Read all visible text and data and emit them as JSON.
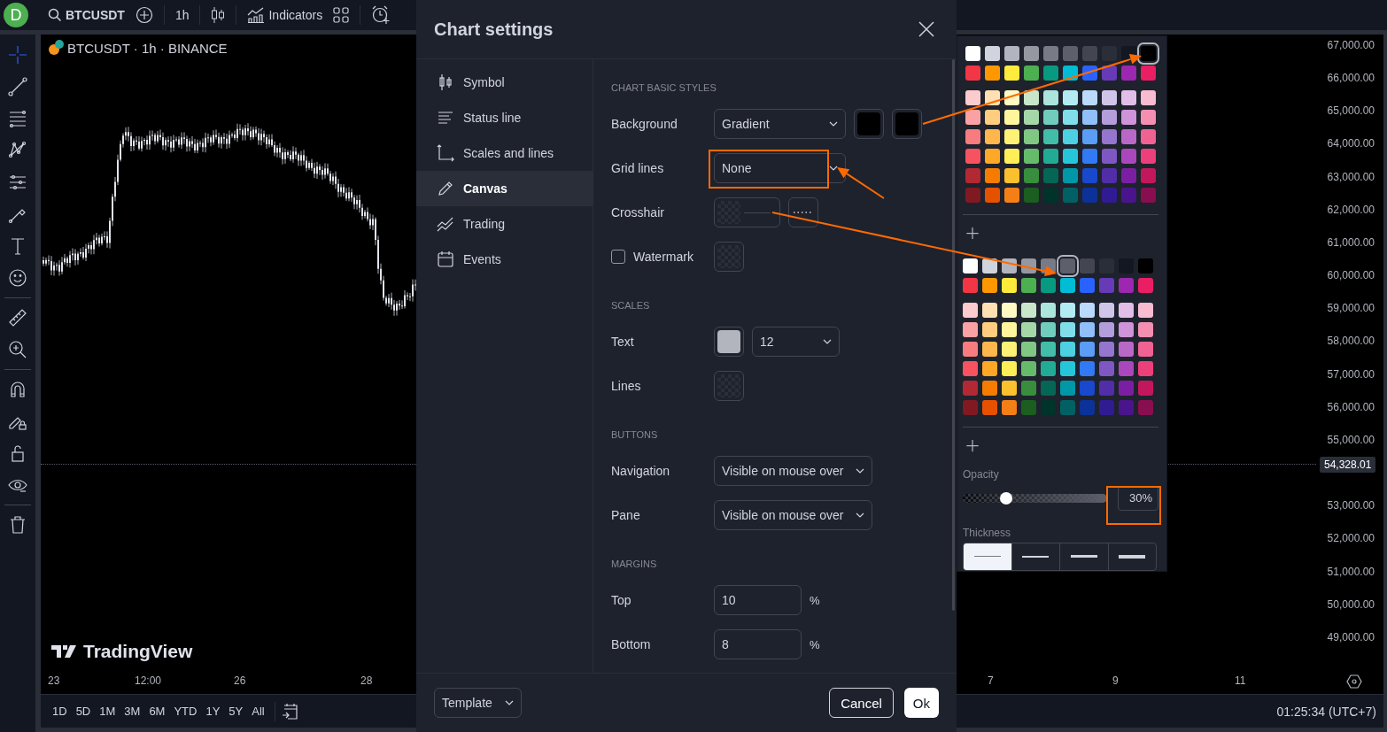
{
  "top_bar": {
    "avatar": "D",
    "symbol": "BTCUSDT",
    "interval": "1h",
    "indicators": "Indicators"
  },
  "tool_groups": [
    {
      "tools": [
        {
          "kind": "crosshair",
          "selected": true
        },
        {
          "kind": "trend-line",
          "selected": false
        },
        {
          "kind": "fib",
          "selected": false
        },
        {
          "kind": "pattern",
          "selected": false
        },
        {
          "kind": "forecast",
          "selected": false
        },
        {
          "kind": "brush",
          "selected": false
        },
        {
          "kind": "text",
          "selected": false
        },
        {
          "kind": "smiley",
          "selected": false
        }
      ]
    },
    {
      "tools": [
        {
          "kind": "ruler",
          "selected": false
        },
        {
          "kind": "zoom",
          "selected": false
        }
      ]
    },
    {
      "tools": [
        {
          "kind": "magnet",
          "selected": false
        },
        {
          "kind": "lock-drawing",
          "selected": false
        },
        {
          "kind": "lock",
          "selected": false
        },
        {
          "kind": "eye",
          "selected": false
        }
      ]
    },
    {
      "tools": [
        {
          "kind": "trash",
          "selected": false
        }
      ]
    }
  ],
  "chart": {
    "legend": "BTCUSDT · 1h · BINANCE",
    "watermark": "TradingView",
    "price_labels": [
      "67,000.00",
      "66,000.00",
      "65,000.00",
      "64,000.00",
      "63,000.00",
      "62,000.00",
      "61,000.00",
      "60,000.00",
      "59,000.00",
      "58,000.00",
      "57,000.00",
      "56,000.00",
      "55,000.00",
      "53,000.00",
      "52,000.00",
      "51,000.00",
      "50,000.00",
      "49,000.00"
    ],
    "last_price": "54,328.01",
    "time_labels": [
      "23",
      "12:00",
      "26",
      "28",
      "7",
      "9",
      "11"
    ]
  },
  "range_bar": {
    "ranges": [
      "1D",
      "5D",
      "1M",
      "3M",
      "6M",
      "YTD",
      "1Y",
      "5Y",
      "All"
    ],
    "clock": "01:25:34 (UTC+7)"
  },
  "dialog": {
    "title": "Chart settings",
    "nav": [
      {
        "kind": "symbol",
        "label": "Symbol",
        "selected": false
      },
      {
        "kind": "status-line",
        "label": "Status line",
        "selected": false
      },
      {
        "kind": "scales",
        "label": "Scales and lines",
        "selected": false
      },
      {
        "kind": "canvas",
        "label": "Canvas",
        "selected": true
      },
      {
        "kind": "trading",
        "label": "Trading",
        "selected": false
      },
      {
        "kind": "events",
        "label": "Events",
        "selected": false
      }
    ],
    "sections": [
      {
        "heading": "CHART BASIC STYLES",
        "rows": [
          {
            "kind": "plain",
            "label": "Background",
            "controls": [
              {
                "kind": "select",
                "value": "Gradient"
              },
              {
                "kind": "swatch",
                "color": "#000000"
              },
              {
                "kind": "swatch",
                "color": "#000000"
              }
            ]
          },
          {
            "kind": "plain",
            "label": "Grid lines",
            "controls": [
              {
                "kind": "select",
                "value": "None"
              }
            ]
          },
          {
            "kind": "plain",
            "label": "Crosshair",
            "controls": [
              {
                "kind": "line-swatch"
              },
              {
                "kind": "line-style"
              }
            ]
          },
          {
            "kind": "checkbox",
            "label": "Watermark",
            "checked": false,
            "controls": [
              {
                "kind": "transparent-swatch"
              }
            ]
          }
        ]
      },
      {
        "heading": "SCALES",
        "rows": [
          {
            "kind": "plain",
            "label": "Text",
            "controls": [
              {
                "kind": "swatch",
                "color": "#b2b5be"
              },
              {
                "kind": "select",
                "value": "12"
              }
            ]
          },
          {
            "kind": "plain",
            "label": "Lines",
            "controls": [
              {
                "kind": "transparent-swatch"
              }
            ]
          }
        ]
      },
      {
        "heading": "BUTTONS",
        "rows": [
          {
            "kind": "plain",
            "label": "Navigation",
            "controls": [
              {
                "kind": "select",
                "value": "Visible on mouse over"
              }
            ]
          },
          {
            "kind": "plain",
            "label": "Pane",
            "controls": [
              {
                "kind": "select",
                "value": "Visible on mouse over"
              }
            ]
          }
        ]
      },
      {
        "heading": "MARGINS",
        "rows": [
          {
            "kind": "plain",
            "label": "Top",
            "controls": [
              {
                "kind": "number",
                "value": "10",
                "unit": "%"
              }
            ]
          },
          {
            "kind": "plain",
            "label": "Bottom",
            "controls": [
              {
                "kind": "number",
                "value": "8",
                "unit": "%"
              }
            ]
          }
        ]
      }
    ],
    "footer": {
      "template": "Template",
      "cancel": "Cancel",
      "ok": "Ok"
    }
  },
  "color_picker": {
    "palettes": [
      {
        "rows": [
          [
            {
              "color": "#ffffff",
              "selected": false
            },
            {
              "color": "#d1d4dc",
              "selected": false
            },
            {
              "color": "#b2b5be",
              "selected": false
            },
            {
              "color": "#9598a1",
              "selected": false
            },
            {
              "color": "#787b86",
              "selected": false
            },
            {
              "color": "#5d606b",
              "selected": false
            },
            {
              "color": "#434651",
              "selected": false
            },
            {
              "color": "#2a2e39",
              "selected": false
            },
            {
              "color": "#131722",
              "selected": false
            },
            {
              "color": "#000000",
              "selected": true
            }
          ],
          [
            {
              "color": "#f23645",
              "selected": false
            },
            {
              "color": "#ff9800",
              "selected": false
            },
            {
              "color": "#ffeb3b",
              "selected": false
            },
            {
              "color": "#4caf50",
              "selected": false
            },
            {
              "color": "#089981",
              "selected": false
            },
            {
              "color": "#00bcd4",
              "selected": false
            },
            {
              "color": "#2962ff",
              "selected": false
            },
            {
              "color": "#673ab7",
              "selected": false
            },
            {
              "color": "#9c27b0",
              "selected": false
            },
            {
              "color": "#e91e63",
              "selected": false
            }
          ],
          [
            {
              "color": "#fccbcd",
              "selected": false
            },
            {
              "color": "#ffe0b2",
              "selected": false
            },
            {
              "color": "#fff9c4",
              "selected": false
            },
            {
              "color": "#c8e6c9",
              "selected": false
            },
            {
              "color": "#ace5dc",
              "selected": false
            },
            {
              "color": "#b2ebf2",
              "selected": false
            },
            {
              "color": "#bbd9fb",
              "selected": false
            },
            {
              "color": "#d1c4e9",
              "selected": false
            },
            {
              "color": "#e1bee7",
              "selected": false
            },
            {
              "color": "#f8bbd0",
              "selected": false
            }
          ],
          [
            {
              "color": "#faa1a4",
              "selected": false
            },
            {
              "color": "#ffcc80",
              "selected": false
            },
            {
              "color": "#fff59d",
              "selected": false
            },
            {
              "color": "#a5d6a7",
              "selected": false
            },
            {
              "color": "#70ccbd",
              "selected": false
            },
            {
              "color": "#80deea",
              "selected": false
            },
            {
              "color": "#90bff9",
              "selected": false
            },
            {
              "color": "#b39ddb",
              "selected": false
            },
            {
              "color": "#ce93d8",
              "selected": false
            },
            {
              "color": "#f48fb1",
              "selected": false
            }
          ],
          [
            {
              "color": "#f77c80",
              "selected": false
            },
            {
              "color": "#ffb74d",
              "selected": false
            },
            {
              "color": "#fff176",
              "selected": false
            },
            {
              "color": "#81c784",
              "selected": false
            },
            {
              "color": "#42bda8",
              "selected": false
            },
            {
              "color": "#4dd0e1",
              "selected": false
            },
            {
              "color": "#5b9cf6",
              "selected": false
            },
            {
              "color": "#9575cd",
              "selected": false
            },
            {
              "color": "#ba68c8",
              "selected": false
            },
            {
              "color": "#f06292",
              "selected": false
            }
          ],
          [
            {
              "color": "#f7525f",
              "selected": false
            },
            {
              "color": "#ffa726",
              "selected": false
            },
            {
              "color": "#ffee58",
              "selected": false
            },
            {
              "color": "#66bb6a",
              "selected": false
            },
            {
              "color": "#22ab94",
              "selected": false
            },
            {
              "color": "#26c6da",
              "selected": false
            },
            {
              "color": "#3179f5",
              "selected": false
            },
            {
              "color": "#7e57c2",
              "selected": false
            },
            {
              "color": "#ab47bc",
              "selected": false
            },
            {
              "color": "#ec407a",
              "selected": false
            }
          ],
          [
            {
              "color": "#b22833",
              "selected": false
            },
            {
              "color": "#f57c00",
              "selected": false
            },
            {
              "color": "#fbc02d",
              "selected": false
            },
            {
              "color": "#388e3c",
              "selected": false
            },
            {
              "color": "#056656",
              "selected": false
            },
            {
              "color": "#0097a7",
              "selected": false
            },
            {
              "color": "#1848cc",
              "selected": false
            },
            {
              "color": "#512da8",
              "selected": false
            },
            {
              "color": "#7b1fa2",
              "selected": false
            },
            {
              "color": "#c2185b",
              "selected": false
            }
          ],
          [
            {
              "color": "#801922",
              "selected": false
            },
            {
              "color": "#e65100",
              "selected": false
            },
            {
              "color": "#f57f17",
              "selected": false
            },
            {
              "color": "#1b5e20",
              "selected": false
            },
            {
              "color": "#00332a",
              "selected": false
            },
            {
              "color": "#006064",
              "selected": false
            },
            {
              "color": "#0c3299",
              "selected": false
            },
            {
              "color": "#311b92",
              "selected": false
            },
            {
              "color": "#4a148c",
              "selected": false
            },
            {
              "color": "#880e4f",
              "selected": false
            }
          ]
        ]
      },
      {
        "rows": [
          [
            {
              "color": "#ffffff",
              "selected": false
            },
            {
              "color": "#d1d4dc",
              "selected": false
            },
            {
              "color": "#b2b5be",
              "selected": false
            },
            {
              "color": "#9598a1",
              "selected": false
            },
            {
              "color": "#787b86",
              "selected": false
            },
            {
              "color": "#5d606b",
              "selected": true
            },
            {
              "color": "#434651",
              "selected": false
            },
            {
              "color": "#2a2e39",
              "selected": false
            },
            {
              "color": "#131722",
              "selected": false
            },
            {
              "color": "#000000",
              "selected": false
            }
          ],
          [
            {
              "color": "#f23645",
              "selected": false
            },
            {
              "color": "#ff9800",
              "selected": false
            },
            {
              "color": "#ffeb3b",
              "selected": false
            },
            {
              "color": "#4caf50",
              "selected": false
            },
            {
              "color": "#089981",
              "selected": false
            },
            {
              "color": "#00bcd4",
              "selected": false
            },
            {
              "color": "#2962ff",
              "selected": false
            },
            {
              "color": "#673ab7",
              "selected": false
            },
            {
              "color": "#9c27b0",
              "selected": false
            },
            {
              "color": "#e91e63",
              "selected": false
            }
          ],
          [
            {
              "color": "#fccbcd",
              "selected": false
            },
            {
              "color": "#ffe0b2",
              "selected": false
            },
            {
              "color": "#fff9c4",
              "selected": false
            },
            {
              "color": "#c8e6c9",
              "selected": false
            },
            {
              "color": "#ace5dc",
              "selected": false
            },
            {
              "color": "#b2ebf2",
              "selected": false
            },
            {
              "color": "#bbd9fb",
              "selected": false
            },
            {
              "color": "#d1c4e9",
              "selected": false
            },
            {
              "color": "#e1bee7",
              "selected": false
            },
            {
              "color": "#f8bbd0",
              "selected": false
            }
          ],
          [
            {
              "color": "#faa1a4",
              "selected": false
            },
            {
              "color": "#ffcc80",
              "selected": false
            },
            {
              "color": "#fff59d",
              "selected": false
            },
            {
              "color": "#a5d6a7",
              "selected": false
            },
            {
              "color": "#70ccbd",
              "selected": false
            },
            {
              "color": "#80deea",
              "selected": false
            },
            {
              "color": "#90bff9",
              "selected": false
            },
            {
              "color": "#b39ddb",
              "selected": false
            },
            {
              "color": "#ce93d8",
              "selected": false
            },
            {
              "color": "#f48fb1",
              "selected": false
            }
          ],
          [
            {
              "color": "#f77c80",
              "selected": false
            },
            {
              "color": "#ffb74d",
              "selected": false
            },
            {
              "color": "#fff176",
              "selected": false
            },
            {
              "color": "#81c784",
              "selected": false
            },
            {
              "color": "#42bda8",
              "selected": false
            },
            {
              "color": "#4dd0e1",
              "selected": false
            },
            {
              "color": "#5b9cf6",
              "selected": false
            },
            {
              "color": "#9575cd",
              "selected": false
            },
            {
              "color": "#ba68c8",
              "selected": false
            },
            {
              "color": "#f06292",
              "selected": false
            }
          ],
          [
            {
              "color": "#f7525f",
              "selected": false
            },
            {
              "color": "#ffa726",
              "selected": false
            },
            {
              "color": "#ffee58",
              "selected": false
            },
            {
              "color": "#66bb6a",
              "selected": false
            },
            {
              "color": "#22ab94",
              "selected": false
            },
            {
              "color": "#26c6da",
              "selected": false
            },
            {
              "color": "#3179f5",
              "selected": false
            },
            {
              "color": "#7e57c2",
              "selected": false
            },
            {
              "color": "#ab47bc",
              "selected": false
            },
            {
              "color": "#ec407a",
              "selected": false
            }
          ],
          [
            {
              "color": "#b22833",
              "selected": false
            },
            {
              "color": "#f57c00",
              "selected": false
            },
            {
              "color": "#fbc02d",
              "selected": false
            },
            {
              "color": "#388e3c",
              "selected": false
            },
            {
              "color": "#056656",
              "selected": false
            },
            {
              "color": "#0097a7",
              "selected": false
            },
            {
              "color": "#1848cc",
              "selected": false
            },
            {
              "color": "#512da8",
              "selected": false
            },
            {
              "color": "#7b1fa2",
              "selected": false
            },
            {
              "color": "#c2185b",
              "selected": false
            }
          ],
          [
            {
              "color": "#801922",
              "selected": false
            },
            {
              "color": "#e65100",
              "selected": false
            },
            {
              "color": "#f57f17",
              "selected": false
            },
            {
              "color": "#1b5e20",
              "selected": false
            },
            {
              "color": "#00332a",
              "selected": false
            },
            {
              "color": "#006064",
              "selected": false
            },
            {
              "color": "#0c3299",
              "selected": false
            },
            {
              "color": "#311b92",
              "selected": false
            },
            {
              "color": "#4a148c",
              "selected": false
            },
            {
              "color": "#880e4f",
              "selected": false
            }
          ]
        ]
      }
    ],
    "opacity_label": "Opacity",
    "opacity": {
      "level": 0.3,
      "reading": "30%"
    },
    "thickness_label": "Thickness",
    "thickness": [
      {
        "selected": true
      },
      {
        "selected": false
      },
      {
        "selected": false
      },
      {
        "selected": false
      }
    ]
  }
}
